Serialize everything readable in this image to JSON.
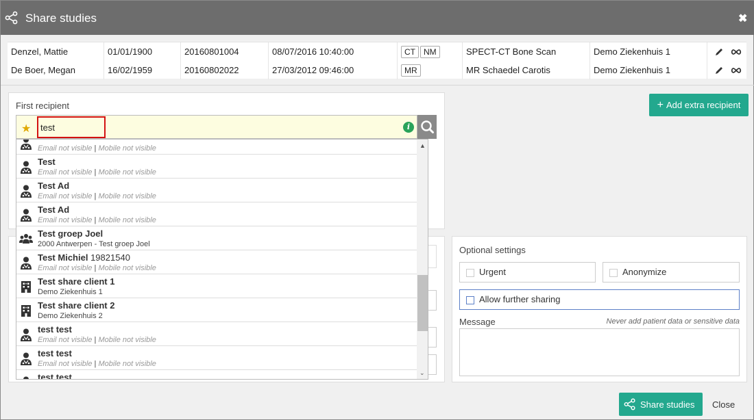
{
  "dialog": {
    "title": "Share studies",
    "close_icon": "close-x-icon"
  },
  "studies": [
    {
      "name": "Denzel, Mattie",
      "dob": "01/01/1900",
      "accession": "20160801004",
      "datetime": "08/07/2016 10:40:00",
      "modalities": [
        "CT",
        "NM"
      ],
      "description": "SPECT-CT Bone Scan",
      "institution": "Demo Ziekenhuis 1"
    },
    {
      "name": "De Boer, Megan",
      "dob": "16/02/1959",
      "accession": "20160802022",
      "datetime": "27/03/2012 09:46:00",
      "modalities": [
        "MR"
      ],
      "description": "MR Schaedel Carotis",
      "institution": "Demo Ziekenhuis 1"
    }
  ],
  "recipient": {
    "label": "First recipient",
    "search_value": "test",
    "info_icon_text": "i",
    "add_extra_label": "Add extra recipient"
  },
  "dropdown": {
    "items": [
      {
        "type": "person",
        "name": "",
        "extra": "",
        "sub_email": "Email not visible",
        "sub_sep": " | ",
        "sub_mobile": "Mobile not visible"
      },
      {
        "type": "person",
        "name": "Test",
        "extra": "",
        "sub_email": "Email not visible",
        "sub_sep": " | ",
        "sub_mobile": "Mobile not visible"
      },
      {
        "type": "person",
        "name": "Test Ad",
        "extra": "",
        "sub_email": "Email not visible",
        "sub_sep": " | ",
        "sub_mobile": "Mobile not visible"
      },
      {
        "type": "person",
        "name": "Test Ad",
        "extra": "",
        "sub_email": "Email not visible",
        "sub_sep": " | ",
        "sub_mobile": "Mobile not visible"
      },
      {
        "type": "group",
        "name": "Test groep Joel",
        "extra": "",
        "sub_plain": "2000 Antwerpen - Test groep Joel"
      },
      {
        "type": "person",
        "name": "Test Michiel",
        "extra": "19821540",
        "sub_email": "Email not visible",
        "sub_sep": " | ",
        "sub_mobile": "Mobile not visible"
      },
      {
        "type": "building",
        "name": "Test share client 1",
        "extra": "",
        "sub_plain": "Demo Ziekenhuis 1"
      },
      {
        "type": "building",
        "name": "Test share client 2",
        "extra": "",
        "sub_plain": "Demo Ziekenhuis 2"
      },
      {
        "type": "person",
        "name": "test test",
        "extra": "",
        "sub_email": "Email not visible",
        "sub_sep": " | ",
        "sub_mobile": "Mobile not visible"
      },
      {
        "type": "person",
        "name": "test test",
        "extra": "",
        "sub_email": "Email not visible",
        "sub_sep": " | ",
        "sub_mobile": "Mobile not visible"
      },
      {
        "type": "person",
        "name": "test test",
        "extra": "",
        "sub_email": "",
        "sub_sep": "",
        "sub_mobile": ""
      }
    ]
  },
  "optional": {
    "title": "Optional settings",
    "urgent": "Urgent",
    "anonymize": "Anonymize",
    "allow_sharing": "Allow further sharing",
    "message_label": "Message",
    "message_hint": "Never add patient data or sensitive data"
  },
  "footer": {
    "share_label": "Share studies",
    "close_label": "Close"
  },
  "colors": {
    "titlebar": "#6d6d6d",
    "accent": "#23a88e",
    "search_bg": "#fdfde0",
    "highlight": "#d31111"
  }
}
